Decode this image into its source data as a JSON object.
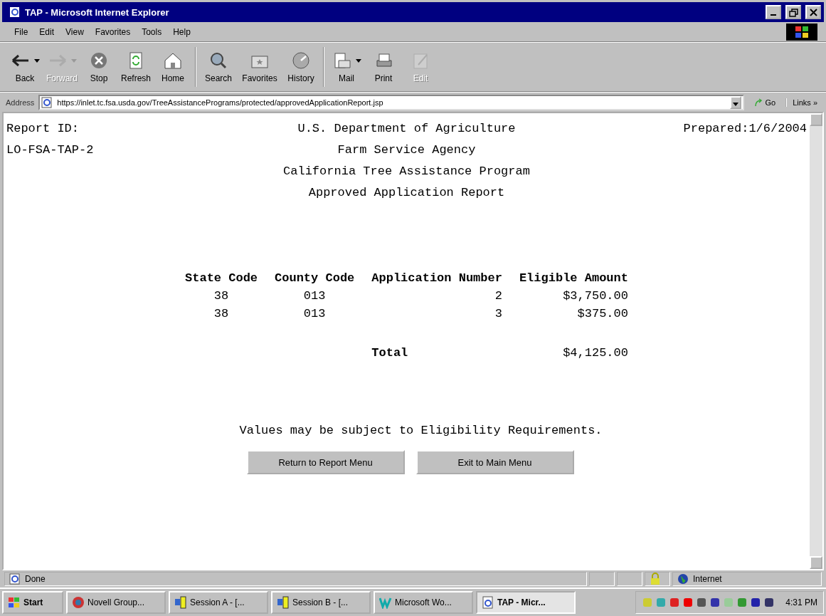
{
  "window": {
    "title": "TAP - Microsoft Internet Explorer"
  },
  "menu": [
    "File",
    "Edit",
    "View",
    "Favorites",
    "Tools",
    "Help"
  ],
  "toolbar": [
    {
      "kind": "back",
      "label": "Back",
      "disabled": false,
      "has_menu": true
    },
    {
      "kind": "forward",
      "label": "Forward",
      "disabled": true,
      "has_menu": true
    },
    {
      "kind": "stop",
      "label": "Stop",
      "disabled": false,
      "has_menu": false
    },
    {
      "kind": "refresh",
      "label": "Refresh",
      "disabled": false,
      "has_menu": false
    },
    {
      "kind": "home",
      "label": "Home",
      "disabled": false,
      "has_menu": false
    },
    {
      "kind": "search",
      "label": "Search",
      "disabled": false,
      "has_menu": false
    },
    {
      "kind": "favorites",
      "label": "Favorites",
      "disabled": false,
      "has_menu": false
    },
    {
      "kind": "history",
      "label": "History",
      "disabled": false,
      "has_menu": false
    },
    {
      "kind": "mail",
      "label": "Mail",
      "disabled": false,
      "has_menu": true
    },
    {
      "kind": "print",
      "label": "Print",
      "disabled": false,
      "has_menu": false
    },
    {
      "kind": "edit",
      "label": "Edit",
      "disabled": true,
      "has_menu": false
    }
  ],
  "address": {
    "label": "Address",
    "url": "https://inlet.tc.fsa.usda.gov/TreeAssistancePrograms/protected/approvedApplicationReport.jsp",
    "go": "Go",
    "links": "Links »"
  },
  "report": {
    "id_label": "Report ID:",
    "id": "LO-FSA-TAP-2",
    "prepared": "Prepared:1/6/2004",
    "headings": [
      "U.S. Department of Agriculture",
      "Farm Service Agency",
      "California Tree Assistance Program",
      "Approved Application Report"
    ],
    "columns": [
      "State Code",
      "County Code",
      "Application Number",
      "Eligible Amount"
    ],
    "rows": [
      [
        "38",
        "013",
        "2",
        "$3,750.00"
      ],
      [
        "38",
        "013",
        "3",
        "$375.00"
      ]
    ],
    "total_label": "Total",
    "total": "$4,125.00",
    "note": "Values may be subject to Eligibility Requirements.",
    "buttons": [
      "Return to Report Menu",
      "Exit to Main Menu"
    ]
  },
  "status_bar": {
    "text": "Done",
    "zone": "Internet",
    "secure": true
  },
  "taskbar": {
    "start": "Start",
    "tasks": [
      {
        "label": "Novell Group...",
        "kind": "novell",
        "selected": false
      },
      {
        "label": "Session A - [...",
        "kind": "session",
        "selected": false
      },
      {
        "label": "Session B - [...",
        "kind": "session",
        "selected": false
      },
      {
        "label": "Microsoft Wo...",
        "kind": "word",
        "selected": false
      },
      {
        "label": "TAP - Micr...",
        "kind": "ie",
        "selected": true
      }
    ],
    "clock": "4:31 PM"
  }
}
